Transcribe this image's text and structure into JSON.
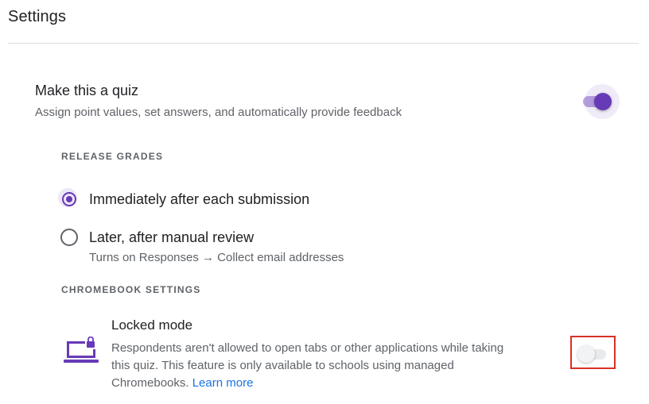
{
  "page": {
    "title": "Settings"
  },
  "quiz": {
    "title": "Make this a quiz",
    "description": "Assign point values, set answers, and automatically provide feedback",
    "toggle_on": true
  },
  "release_grades": {
    "header": "RELEASE GRADES",
    "options": [
      {
        "label": "Immediately after each submission",
        "checked": true
      },
      {
        "label": "Later, after manual review",
        "checked": false,
        "sub": "Turns on Responses → Collect email addresses"
      }
    ]
  },
  "chromebook": {
    "header": "CHROMEBOOK SETTINGS",
    "locked_mode": {
      "title": "Locked mode",
      "description": "Respondents aren't allowed to open tabs or other applications while taking this quiz. This feature is only available to schools using managed Chromebooks.",
      "link": "Learn more",
      "toggle_on": false
    }
  },
  "colors": {
    "accent": "#673ab7",
    "link": "#1a73e8",
    "highlight": "#d93025"
  },
  "icons": {
    "locked_mode": "laptop-lock-icon"
  }
}
